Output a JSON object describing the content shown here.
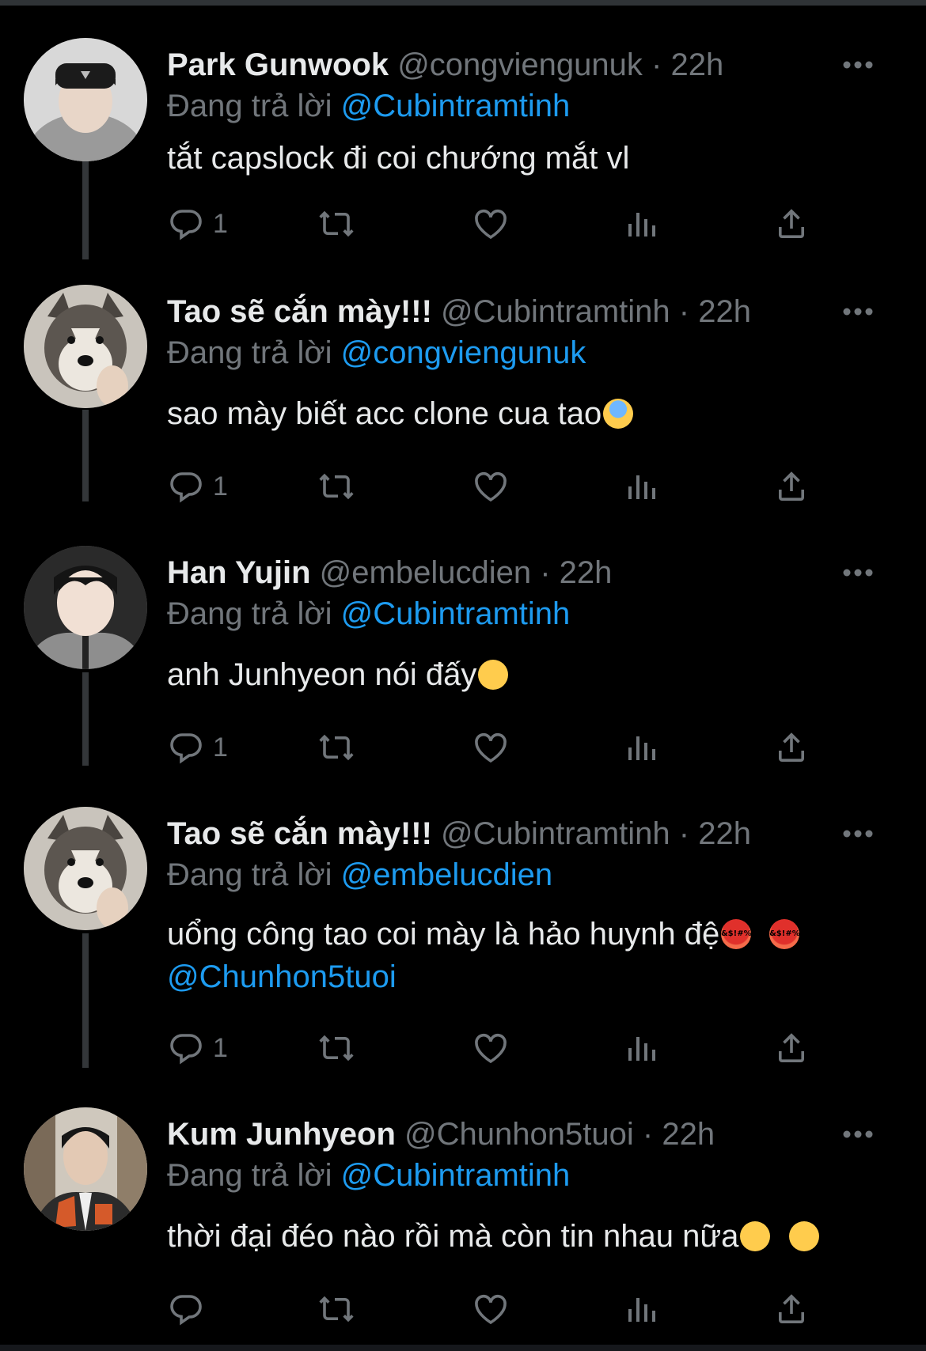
{
  "tweets": [
    {
      "name": "Park Gunwook",
      "handle": "@congviengunuk",
      "dot": "·",
      "time": "22h",
      "replying_label": "Đang trả lời",
      "replying_to": "@Cubintramtinh",
      "text": "tắt capslock đi coi chướng mắt vl",
      "reply_count": "1",
      "avatar_desc": "person-black-cap"
    },
    {
      "name": "Tao sẽ cắn mày!!!",
      "handle": "@Cubintramtinh",
      "dot": "·",
      "time": "22h",
      "replying_label": "Đang trả lời",
      "replying_to": "@congviengunuk",
      "text": "sao mày biết acc clone cua tao",
      "reply_count": "1",
      "avatar_desc": "husky-dog"
    },
    {
      "name": "Han Yujin",
      "handle": "@embelucdien",
      "dot": "·",
      "time": "22h",
      "replying_label": "Đang trả lời",
      "replying_to": "@Cubintramtinh",
      "text": "anh Junhyeon nói đấy",
      "reply_count": "1",
      "avatar_desc": "person-grey-jacket"
    },
    {
      "name": "Tao sẽ cắn mày!!!",
      "handle": "@Cubintramtinh",
      "dot": "·",
      "time": "22h",
      "replying_label": "Đang trả lời",
      "replying_to": "@embelucdien",
      "text": "uổng công tao coi mày là hảo huynh đệ",
      "mention_line": "@Chunhon5tuoi",
      "reply_count": "1",
      "avatar_desc": "husky-dog"
    },
    {
      "name": "Kum Junhyeon",
      "handle": "@Chunhon5tuoi",
      "dot": "·",
      "time": "22h",
      "replying_label": "Đang trả lời",
      "replying_to": "@Cubintramtinh",
      "text": "thời đại đéo nào rồi mà còn tin nhau nữa",
      "reply_count": "",
      "avatar_desc": "person-varsity-jacket"
    }
  ],
  "emoji_text": {
    "curse": "&$!#%"
  },
  "icons": {
    "reply": "reply-icon",
    "retweet": "retweet-icon",
    "like": "heart-icon",
    "views": "views-icon",
    "share": "share-icon",
    "more": "more-icon"
  },
  "colors": {
    "background": "#000000",
    "text": "#e7e9ea",
    "secondary": "#71767b",
    "accent": "#1d9bf0"
  }
}
